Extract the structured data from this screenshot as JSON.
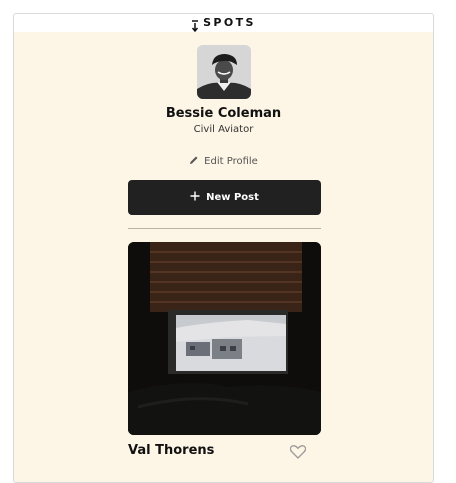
{
  "header": {
    "logo_text": "SPOTS",
    "logo_icon": "spots-logo-icon"
  },
  "profile": {
    "name": "Bessie Coleman",
    "job": "Civil Aviator",
    "edit_label": "Edit Profile",
    "edit_icon": "pencil-icon"
  },
  "actions": {
    "new_post_label": "New Post",
    "new_post_icon": "plus-icon"
  },
  "cards": [
    {
      "title": "Val Thorens",
      "like_icon": "heart-icon",
      "liked": false
    }
  ],
  "colors": {
    "page_background": "#fdf5e6",
    "button": "#212121",
    "text": "#111111"
  }
}
